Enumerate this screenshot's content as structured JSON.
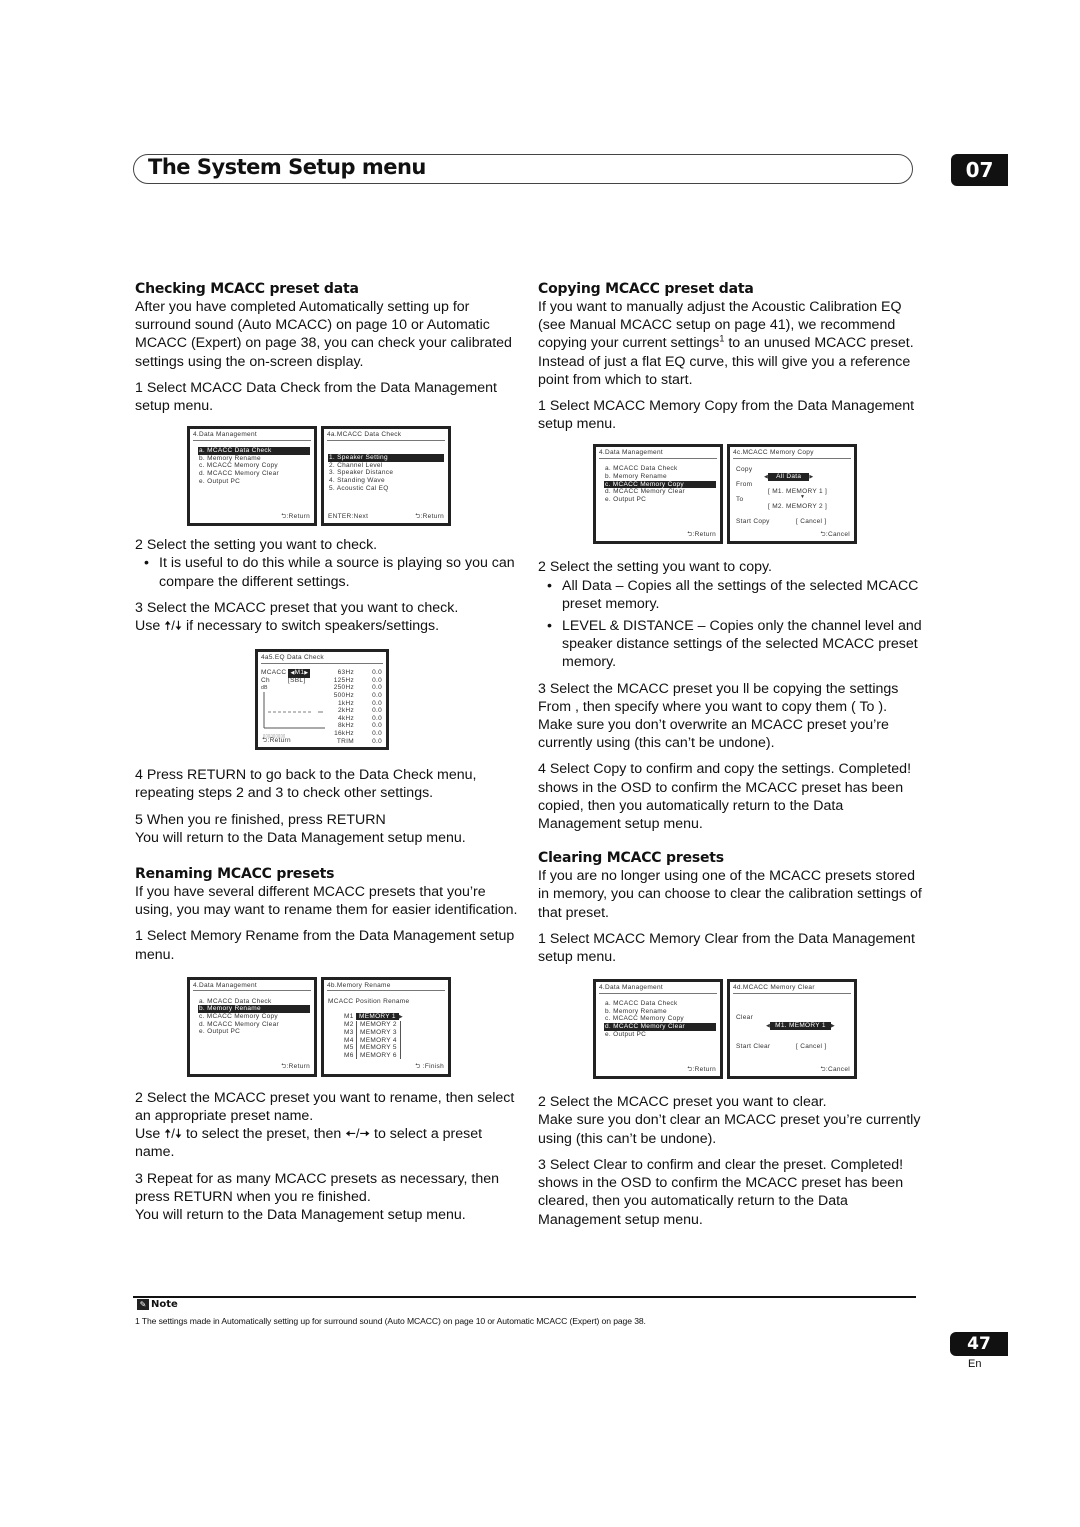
{
  "header": {
    "title": "The System Setup menu",
    "chapter": "07"
  },
  "left": {
    "checking": {
      "heading": "Checking MCACC preset data",
      "intro": "After you have completed Automatically setting up for surround sound (Auto MCACC) on page 10 or Automatic MCACC (Expert) on page 38, you can check your calibrated settings using the on-screen display.",
      "step1": "1    Select  MCACC Data Check  from the Data Management setup menu.",
      "step2": "2    Select the setting   you want to check.",
      "step2_bullet": "It is useful to do this while a source is playing so you can compare the different settings.",
      "step3a": "3    Select the MCACC preset that you want to check.",
      "step3b_pre": "Use ",
      "step3b_arrows": "🠅/🠇",
      "step3b_post": " if necessary to switch speakers/settings.",
      "step4": "4    Press RETURN to go back to the Data Check menu, repeating steps 2 and 3 to    check other settings.",
      "step5": "5    When you re finished, press    RETURN",
      "step5b": "You will return to the Data Management setup menu."
    },
    "renaming": {
      "heading": "Renaming MCACC presets",
      "intro": "If you have several different MCACC presets that you’re using, you may want to rename them for easier identification.",
      "step1": "1    Select  Memory Rename    from the Data Management setup menu.",
      "step2": "2    Select the MCACC preset you want to rename, then select an appropriate preset name.",
      "step2b_pre": "Use ",
      "step2b_arrows1": "🠅/🠇",
      "step2b_mid": " to select the preset, then ",
      "step2b_arrows2": "🠄/🠆",
      "step2b_post": " to select a preset name.",
      "step3": "3    Repeat for as many MCACC presets as necessary, then press  RETURN when you re finished.",
      "step3b": "You will return to the Data Management setup menu."
    }
  },
  "right": {
    "copying": {
      "heading": "Copying MCACC preset data",
      "intro_pre": "If you want to manually adjust the Acoustic Calibration EQ (see Manual MCACC setup on page 41), we recommend copying your current settings",
      "intro_sup": "1",
      "intro_post": " to an unused MCACC preset. Instead of just a flat EQ curve, this will give you a reference point from which to start.",
      "step1": "1    Select  MCACC Memory Copy   from the Data Management setup menu.",
      "step2": "2    Select the setting you want to copy.",
      "bullet1": "All Data – Copies all the settings of the selected MCACC preset memory.",
      "bullet2": "LEVEL & DISTANCE – Copies only the channel level and speaker distance settings of the selected MCACC preset memory.",
      "step3": "3    Select the MCACC preset you ll be copying the settings   From , then specify where you want to copy them (  To ).",
      "step3b": "Make sure you don’t overwrite an MCACC preset you’re currently using (this can’t be undone).",
      "step4": "4    Select  Copy   to confirm and copy the settings. Completed!   shows in the OSD to confirm the MCACC preset has been copied, then you automatically return to the Data Management setup menu."
    },
    "clearing": {
      "heading": "Clearing MCACC presets",
      "intro": "If you are no longer using one of the MCACC presets stored in memory, you can choose to clear the calibration settings of that preset.",
      "step1": "1    Select  MCACC Memory Clear   from the Data Management setup menu.",
      "step2": "2    Select the MCACC preset you want to clear.",
      "step2b": "Make sure you don’t clear an MCACC preset you’re currently using (this can’t be undone).",
      "step3": "3    Select  Clear  to confirm and clear the preset. Completed!   shows in the OSD to confirm the MCACC preset has been cleared, then you automatically return to the Data Management setup menu."
    }
  },
  "osd": {
    "data_mgmt": {
      "title": "4.Data  Management",
      "items": [
        "a. MCACC  Data  Check",
        "b. Memory  Rename",
        "c. MCACC  Memory  Copy",
        "d. MCACC  Memory  Clear",
        "e. Output  PC"
      ],
      "footer": ":Return"
    },
    "data_check": {
      "title": "4a.MCACC  Data  Check",
      "items": [
        "1. Speaker  Setting",
        "2. Channel  Level",
        "3. Speaker  Distance",
        "4. Standing  Wave",
        "5. Acoustic  Cal  EQ"
      ],
      "footer_left": "ENTER:Next",
      "footer_right": ":Return"
    },
    "eq_check": {
      "title": "4a5.EQ  Data  Check",
      "mcacc_label": "MCACC",
      "mcacc_value": "M1",
      "ch_label": "Ch",
      "ch_value": "[SBL]",
      "db_label": "dB",
      "bands": [
        {
          "freq": "63Hz",
          "value": "0.0"
        },
        {
          "freq": "125Hz",
          "value": "0.0"
        },
        {
          "freq": "250Hz",
          "value": "0.0"
        },
        {
          "freq": "500Hz",
          "value": "0.0"
        },
        {
          "freq": "1kHz",
          "value": "0.0"
        },
        {
          "freq": "2kHz",
          "value": "0.0"
        },
        {
          "freq": "4kHz",
          "value": "0.0"
        },
        {
          "freq": "8kHz",
          "value": "0.0"
        },
        {
          "freq": "16kHz",
          "value": "0.0"
        },
        {
          "freq": "TRIM",
          "value": "0.0"
        }
      ],
      "footer": ":Return"
    },
    "memory_copy": {
      "title": "4c.MCACC  Memory  Copy",
      "copy_label": "Copy",
      "copy_value": "All Data",
      "from_label": "From",
      "from_value": "[ M1. MEMORY 1 ]",
      "to_label": "To",
      "to_value": "[ M2. MEMORY 2 ]",
      "start_label": "Start Copy",
      "start_value": "[ Cancel ]",
      "footer": ":Cancel"
    },
    "memory_rename": {
      "title": "4b.Memory  Rename",
      "subtitle": "MCACC  Position  Rename",
      "rows": [
        {
          "pos": "M1",
          "name": "MEMORY  1"
        },
        {
          "pos": "M2",
          "name": "MEMORY  2"
        },
        {
          "pos": "M3",
          "name": "MEMORY  3"
        },
        {
          "pos": "M4",
          "name": "MEMORY  4"
        },
        {
          "pos": "M5",
          "name": "MEMORY  5"
        },
        {
          "pos": "M6",
          "name": "MEMORY  6"
        }
      ],
      "footer": " :Finish"
    },
    "memory_clear": {
      "title": "4d.MCACC  Memory  Clear",
      "clear_label": "Clear",
      "clear_value": "M1. MEMORY 1",
      "start_label": "Start Clear",
      "start_value": "[ Cancel ]",
      "footer": ":Cancel"
    }
  },
  "note": {
    "label": "Note",
    "text": "1 The settings made in Automatically setting up for surround sound (Auto MCACC) on page 10 or Automatic MCACC (Expert) on page 38."
  },
  "footer": {
    "page": "47",
    "lang": "En"
  }
}
